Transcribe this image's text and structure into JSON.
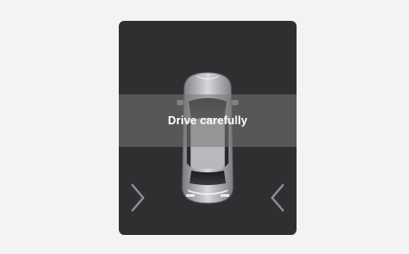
{
  "message": {
    "text": "Drive carefully"
  },
  "icons": {
    "vehicle": "car-top-view-icon",
    "left": "chevron-right-icon",
    "right": "chevron-left-icon"
  },
  "colors": {
    "panel": "#2f2f31",
    "banner": "#6e6e70",
    "background": "#f3f3f3"
  }
}
